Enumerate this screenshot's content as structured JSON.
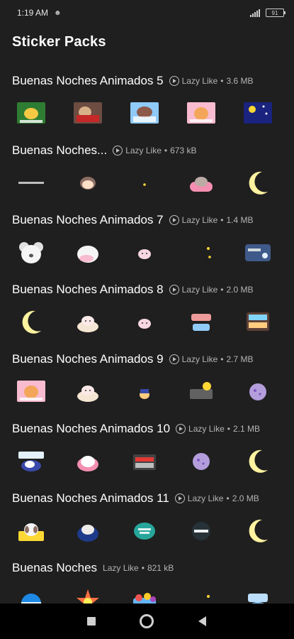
{
  "status_bar": {
    "time": "1:19 AM",
    "battery": "91"
  },
  "header": {
    "title": "Sticker Packs"
  },
  "packs": [
    {
      "name": "Buenas Noches Animados 5",
      "author": "Lazy Like",
      "size": "3.6 MB",
      "animated": true,
      "stickers": [
        "yellow-cat-sticker",
        "bear-blanket-sticker",
        "sleeping-girl-sticker",
        "pink-bunny-sticker",
        "night-sky-sticker"
      ]
    },
    {
      "name": "Buenas Noches...",
      "author": "Lazy Like",
      "size": "673 kB",
      "animated": true,
      "stickers": [
        "text-sticker",
        "girl-face-sticker",
        "small-star-sticker",
        "cat-pillow-sticker",
        "moon-sticker"
      ]
    },
    {
      "name": "Buenas Noches Animados 7",
      "author": "Lazy Like",
      "size": "1.4 MB",
      "animated": true,
      "stickers": [
        "koala-sticker",
        "white-bear-sticker",
        "pink-mochi-sticker",
        "moon-stars-sticker",
        "blue-card-sticker"
      ]
    },
    {
      "name": "Buenas Noches Animados 8",
      "author": "Lazy Like",
      "size": "2.0 MB",
      "animated": true,
      "stickers": [
        "moon-sticker",
        "cat-bed-sticker",
        "pink-mochi-sticker",
        "good-night-text-sticker",
        "brown-sign-sticker"
      ]
    },
    {
      "name": "Buenas Noches Animados 9",
      "author": "Lazy Like",
      "size": "2.7 MB",
      "animated": true,
      "stickers": [
        "pink-bunny-sticker",
        "cat-bed-sticker",
        "small-pet-sticker",
        "night-text-sticker",
        "purple-moon-sticker"
      ]
    },
    {
      "name": "Buenas Noches Animados 10",
      "author": "Lazy Like",
      "size": "2.1 MB",
      "animated": true,
      "stickers": [
        "night-night-sticker",
        "bunny-blanket-sticker",
        "bed-sticker",
        "purple-moon-sticker",
        "moon-sticker"
      ]
    },
    {
      "name": "Buenas Noches Animados 11",
      "author": "Lazy Like",
      "size": "2.0 MB",
      "animated": true,
      "stickers": [
        "dog-sticker",
        "sleeping-bear-sticker",
        "good-night-bubble-sticker",
        "good-night-dark-sticker",
        "moon-sticker"
      ]
    },
    {
      "name": "Buenas Noches",
      "author": "Lazy Like",
      "size": "821 kB",
      "animated": false,
      "stickers": [
        "blue-globe-sticker",
        "colorful-burst-sticker",
        "cartoon-group-sticker",
        "moon-stars-sticker",
        "dulces-sticker"
      ]
    }
  ],
  "nav": [
    "recent-apps",
    "home",
    "back"
  ]
}
